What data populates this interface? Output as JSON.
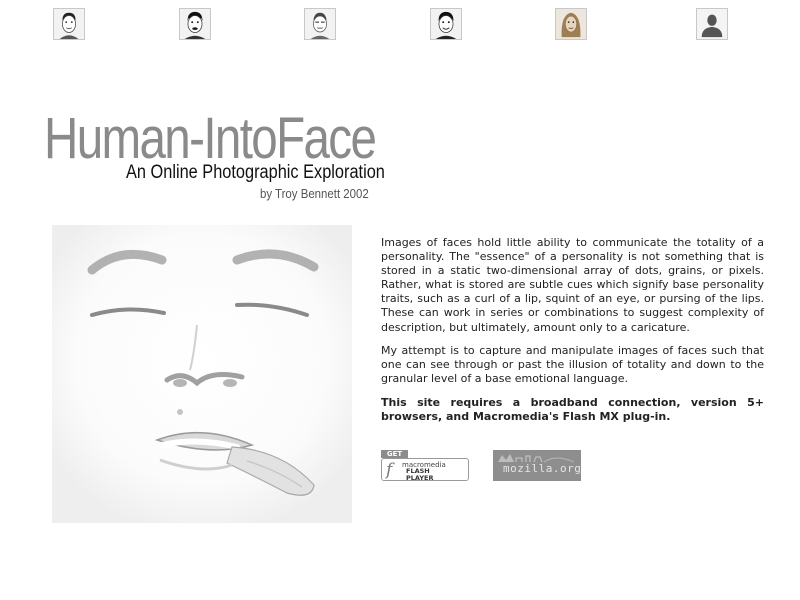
{
  "thumbnails": [
    {
      "name": "face-1",
      "icon": "portrait-icon"
    },
    {
      "name": "face-2",
      "icon": "portrait-icon"
    },
    {
      "name": "face-3",
      "icon": "portrait-icon"
    },
    {
      "name": "face-4",
      "icon": "portrait-icon"
    },
    {
      "name": "face-5",
      "icon": "portrait-icon"
    },
    {
      "name": "face-6",
      "icon": "silhouette-icon"
    }
  ],
  "header": {
    "title": "Human-IntoFace",
    "subtitle": "An Online Photographic Exploration",
    "byline": "by Troy Bennett 2002"
  },
  "intro": {
    "paragraph1": "Images of faces hold little ability to communicate the totality of a personality. The \"essence\" of a personality is not something that is stored in a static two-dimensional array of dots, grains, or pixels. Rather, what is stored are subtle cues which signify base personality traits, such as a curl of a lip, squint of an eye, or pursing of the lips. These can work in series or combinations to suggest complexity of description, but ultimately, amount only to a caricature.",
    "paragraph2": "My attempt is to capture and manipulate images of faces such that one can see through or past the illusion of totality and down to the granular level of a base emotional language.",
    "requirements": "This site requires a broadband connection, version 5+ browsers, and Macromedia's Flash MX plug-in."
  },
  "badges": {
    "flash": {
      "get": "GET",
      "line1": "macromedia",
      "line2": "FLASH",
      "line3": "PLAYER"
    },
    "mozilla": {
      "label": "mozilla.org"
    }
  }
}
